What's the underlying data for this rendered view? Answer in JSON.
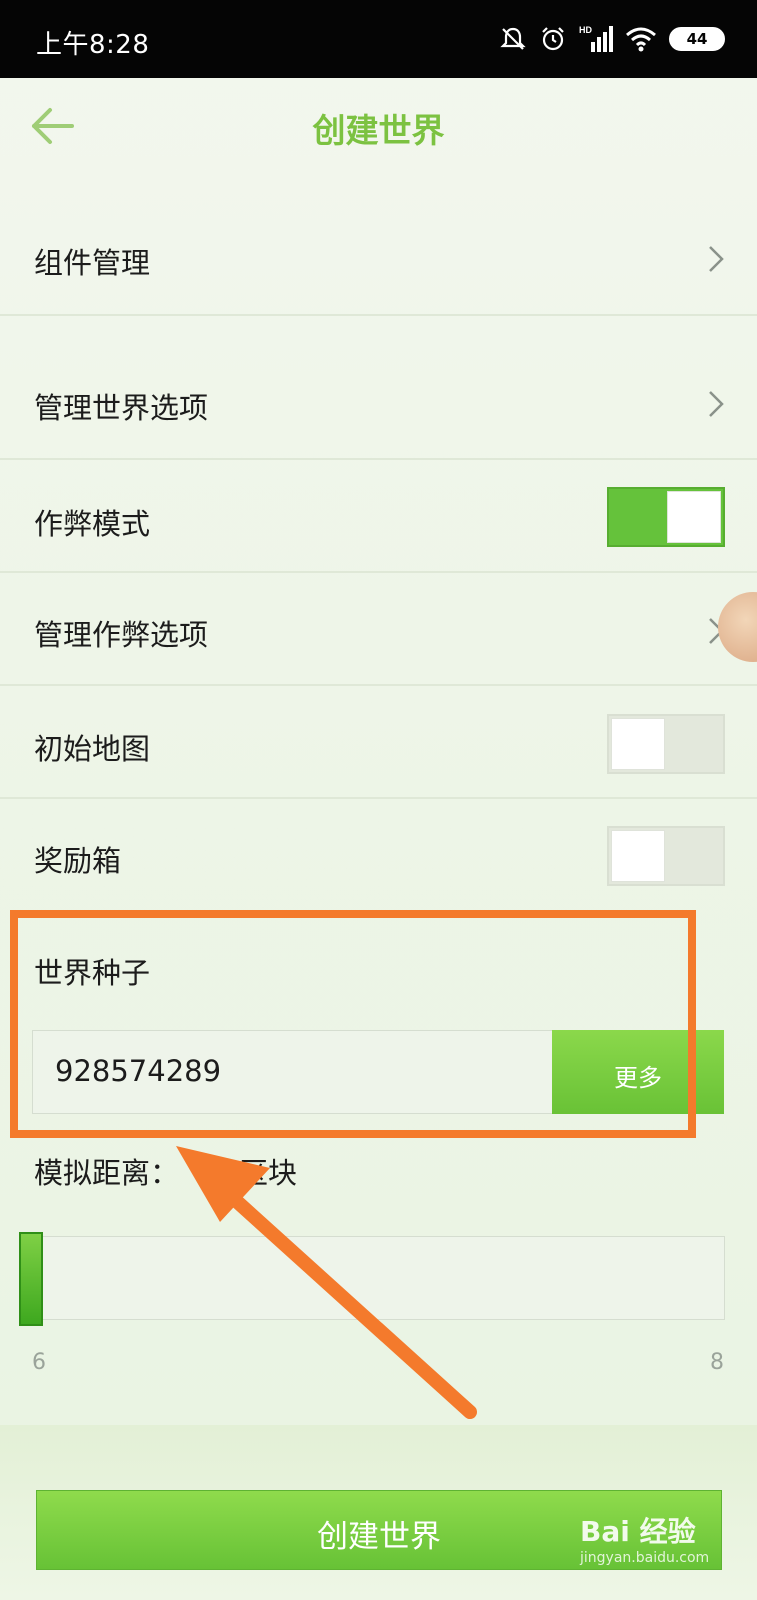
{
  "status_bar": {
    "time": "上午8:28",
    "battery": "44",
    "icons": [
      "mute-icon",
      "alarm-icon",
      "hd-signal-icon",
      "wifi-icon",
      "battery-icon"
    ]
  },
  "header": {
    "title": "创建世界",
    "back_icon": "arrow-left-icon"
  },
  "settings": {
    "addon_management": "组件管理",
    "manage_world_options": "管理世界选项",
    "cheat_mode": {
      "label": "作弊模式",
      "enabled": true
    },
    "manage_cheat_options": "管理作弊选项",
    "starter_map": {
      "label": "初始地图",
      "enabled": false
    },
    "bonus_chest": {
      "label": "奖励箱",
      "enabled": false
    }
  },
  "seed": {
    "label": "世界种子",
    "value": "928574289",
    "more_label": "更多"
  },
  "simulation_distance": {
    "label": "模拟距离：",
    "label_suffix": "区块",
    "min": "6",
    "max": "8",
    "level": 0
  },
  "create_button": "创建世界",
  "watermark": {
    "brand": "Bai 经验",
    "url": "jingyan.baidu.com"
  },
  "colors": {
    "accent": "#7cc241",
    "toggle_on": "#65c23b",
    "highlight": "#f47a2c"
  }
}
